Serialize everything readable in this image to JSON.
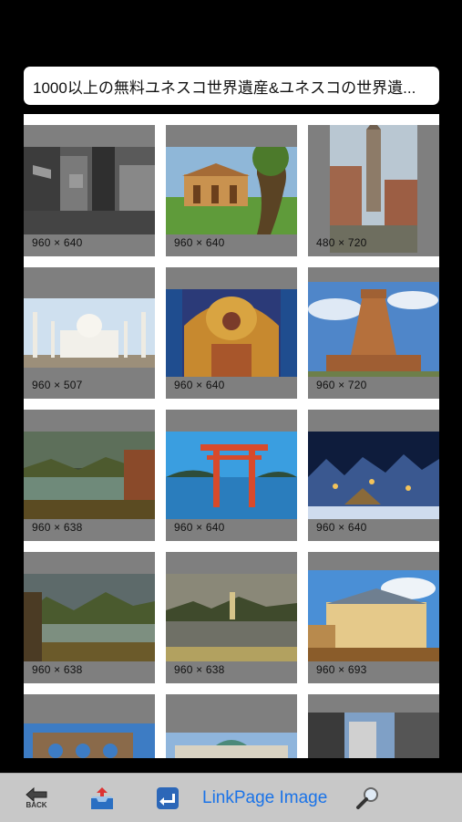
{
  "header": {
    "title": "1000以上の無料ユネスコ世界遺産&ユネスコの世界遺..."
  },
  "grid": {
    "items": [
      {
        "dims": "960 × 640"
      },
      {
        "dims": "960 × 640"
      },
      {
        "dims": "480 × 720"
      },
      {
        "dims": "960 × 507"
      },
      {
        "dims": "960 × 640"
      },
      {
        "dims": "960 × 720"
      },
      {
        "dims": "960 × 638"
      },
      {
        "dims": "960 × 640"
      },
      {
        "dims": "960 × 640"
      },
      {
        "dims": "960 × 638"
      },
      {
        "dims": "960 × 638"
      },
      {
        "dims": "960 × 693"
      }
    ]
  },
  "toolbar": {
    "back_label": "BACK",
    "link_label": "LinkPage Image",
    "icons": [
      "back-arrow-icon",
      "inbox-tray-icon",
      "reply-icon",
      "magnifier-icon"
    ]
  }
}
